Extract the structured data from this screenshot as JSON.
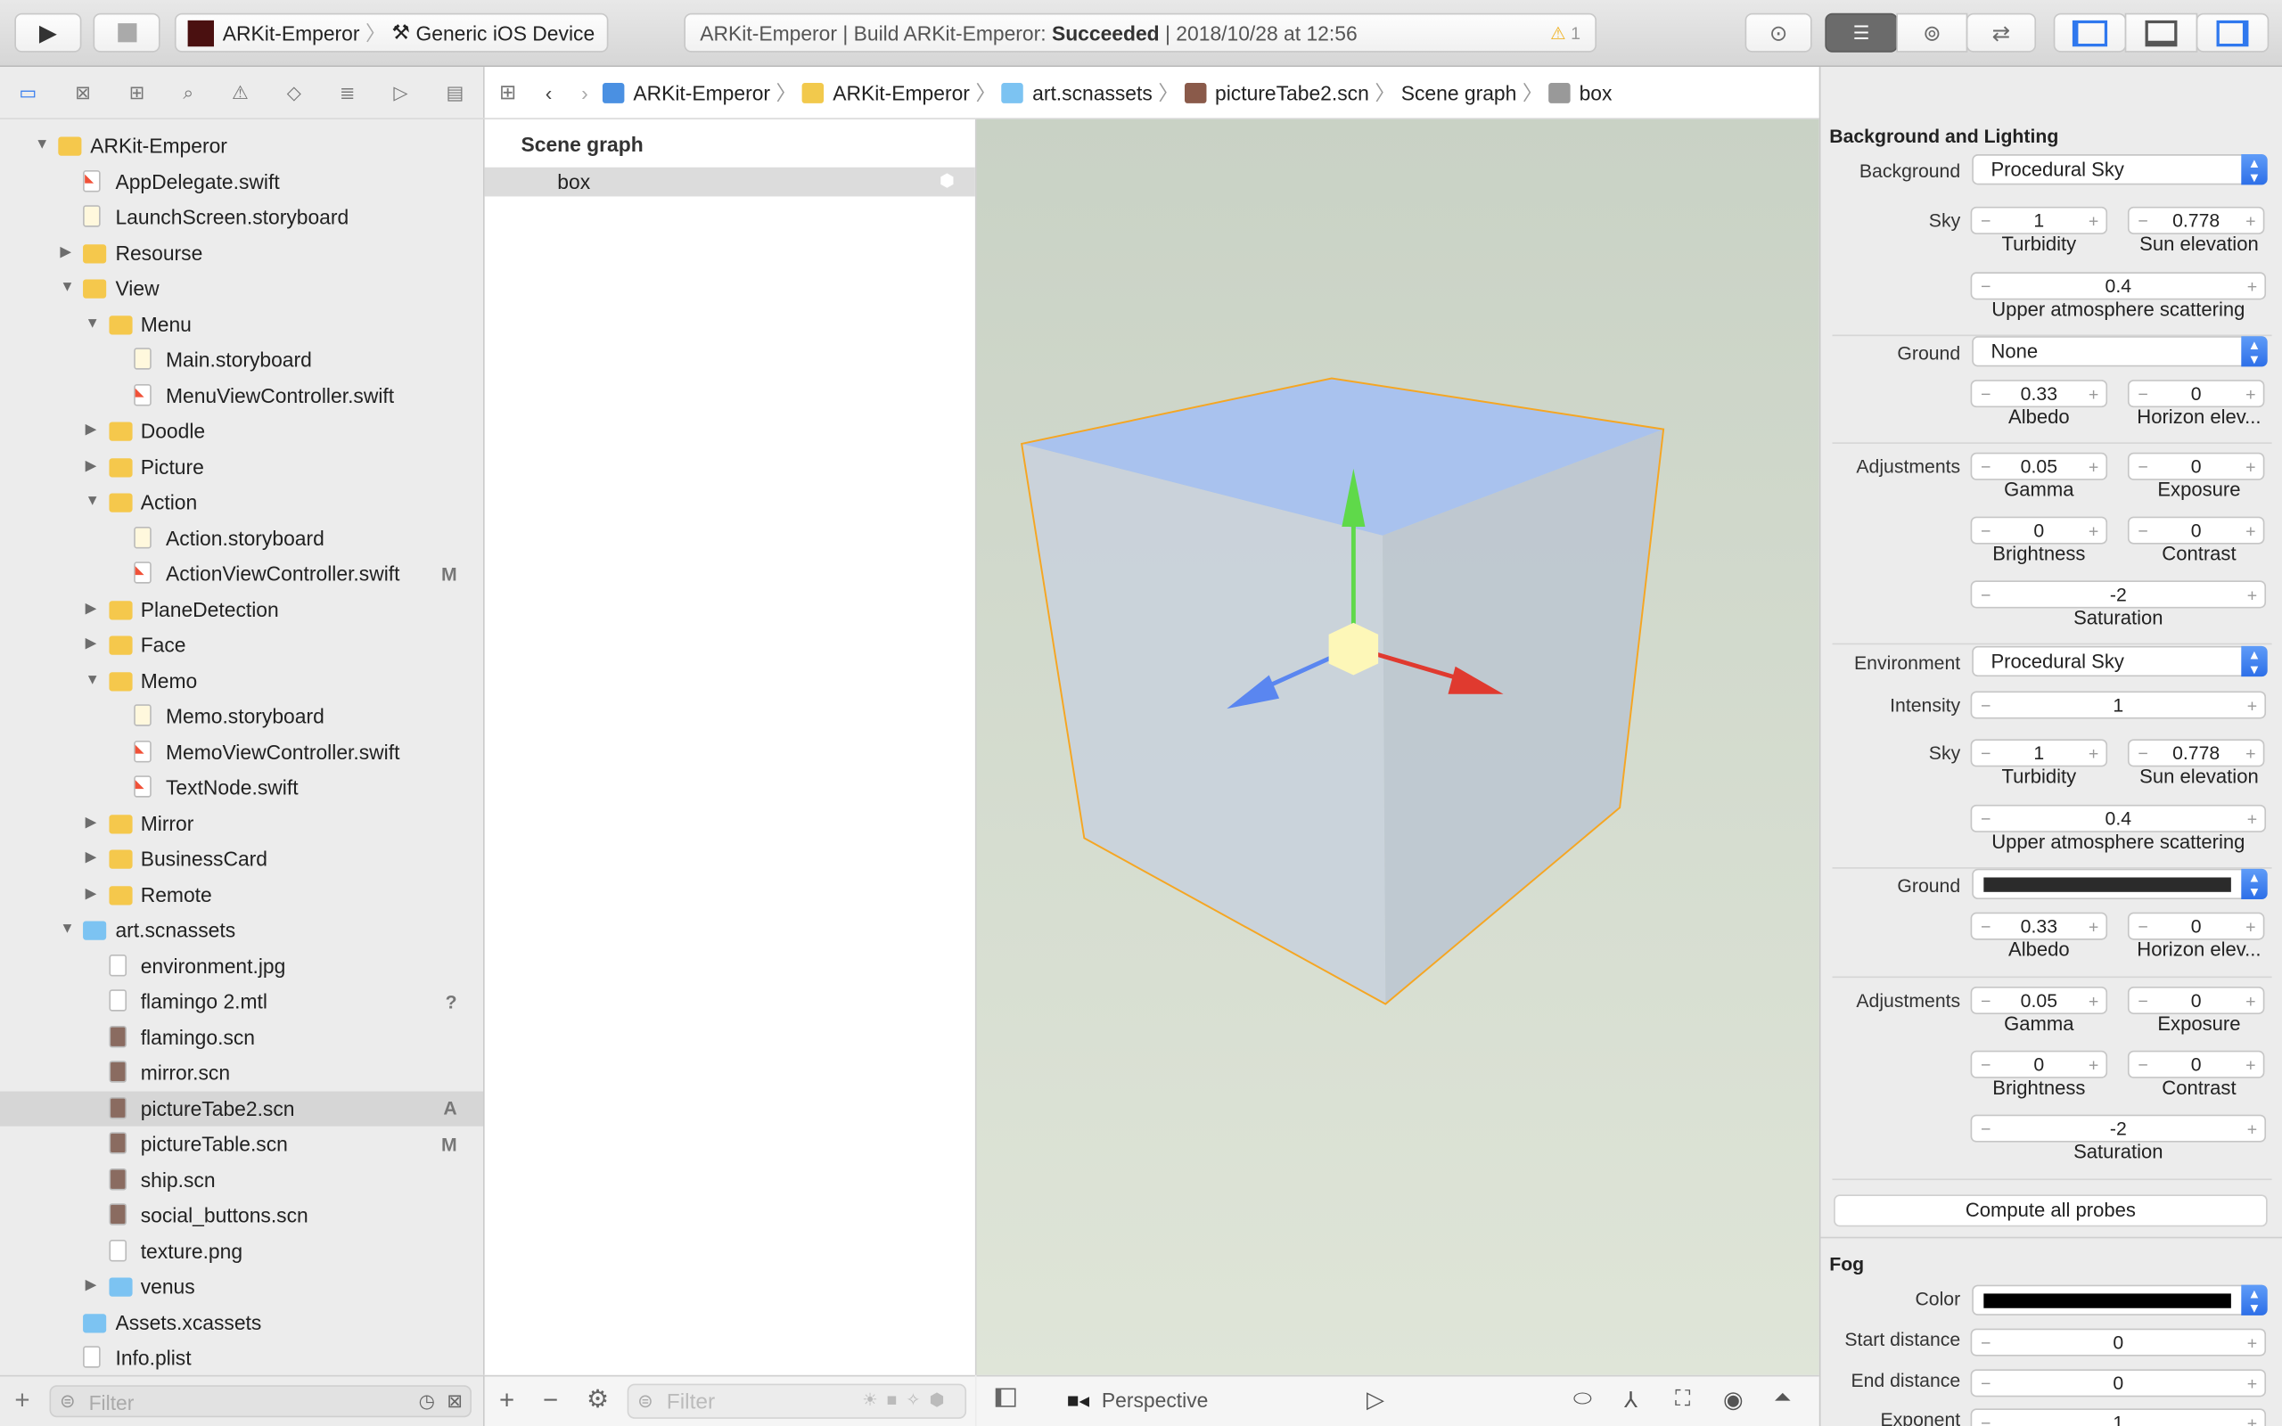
{
  "toolbar": {
    "scheme": "ARKit-Emperor",
    "device": "Generic iOS Device",
    "status_prefix": "ARKit-Emperor | Build ARKit-Emperor: ",
    "status_result": "Succeeded",
    "status_time": " | 2018/10/28 at 12:56",
    "warnings": "1"
  },
  "pathbar": [
    "ARKit-Emperor",
    "ARKit-Emperor",
    "art.scnassets",
    "pictureTabe2.scn",
    "Scene graph",
    "box"
  ],
  "navigator": {
    "filter_placeholder": "Filter",
    "items": [
      {
        "label": "ARKit-Emperor",
        "level": 0,
        "type": "folder",
        "open": true
      },
      {
        "label": "AppDelegate.swift",
        "level": 1,
        "type": "swift"
      },
      {
        "label": "LaunchScreen.storyboard",
        "level": 1,
        "type": "storyboard"
      },
      {
        "label": "Resourse",
        "level": 1,
        "type": "folder",
        "open": false
      },
      {
        "label": "View",
        "level": 1,
        "type": "folder",
        "open": true
      },
      {
        "label": "Menu",
        "level": 2,
        "type": "folder",
        "open": true
      },
      {
        "label": "Main.storyboard",
        "level": 3,
        "type": "storyboard"
      },
      {
        "label": "MenuViewController.swift",
        "level": 3,
        "type": "swift"
      },
      {
        "label": "Doodle",
        "level": 2,
        "type": "folder",
        "open": false
      },
      {
        "label": "Picture",
        "level": 2,
        "type": "folder",
        "open": false
      },
      {
        "label": "Action",
        "level": 2,
        "type": "folder",
        "open": true
      },
      {
        "label": "Action.storyboard",
        "level": 3,
        "type": "storyboard"
      },
      {
        "label": "ActionViewController.swift",
        "level": 3,
        "type": "swift",
        "badge": "M"
      },
      {
        "label": "PlaneDetection",
        "level": 2,
        "type": "folder",
        "open": false
      },
      {
        "label": "Face",
        "level": 2,
        "type": "folder",
        "open": false
      },
      {
        "label": "Memo",
        "level": 2,
        "type": "folder",
        "open": true
      },
      {
        "label": "Memo.storyboard",
        "level": 3,
        "type": "storyboard"
      },
      {
        "label": "MemoViewController.swift",
        "level": 3,
        "type": "swift"
      },
      {
        "label": "TextNode.swift",
        "level": 3,
        "type": "swift"
      },
      {
        "label": "Mirror",
        "level": 2,
        "type": "folder",
        "open": false
      },
      {
        "label": "BusinessCard",
        "level": 2,
        "type": "folder",
        "open": false
      },
      {
        "label": "Remote",
        "level": 2,
        "type": "folder",
        "open": false
      },
      {
        "label": "art.scnassets",
        "level": 1,
        "type": "bluefolder",
        "open": true
      },
      {
        "label": "environment.jpg",
        "level": 2,
        "type": "image"
      },
      {
        "label": "flamingo 2.mtl",
        "level": 2,
        "type": "file",
        "badge": "?"
      },
      {
        "label": "flamingo.scn",
        "level": 2,
        "type": "scn"
      },
      {
        "label": "mirror.scn",
        "level": 2,
        "type": "scn"
      },
      {
        "label": "pictureTabe2.scn",
        "level": 2,
        "type": "scn",
        "badge": "A",
        "selected": true
      },
      {
        "label": "pictureTable.scn",
        "level": 2,
        "type": "scn",
        "badge": "M"
      },
      {
        "label": "ship.scn",
        "level": 2,
        "type": "scn"
      },
      {
        "label": "social_buttons.scn",
        "level": 2,
        "type": "scn"
      },
      {
        "label": "texture.png",
        "level": 2,
        "type": "image"
      },
      {
        "label": "venus",
        "level": 2,
        "type": "bluefolder",
        "open": false
      },
      {
        "label": "Assets.xcassets",
        "level": 1,
        "type": "bluefolder"
      },
      {
        "label": "Info.plist",
        "level": 1,
        "type": "file"
      }
    ]
  },
  "scene": {
    "title": "Scene graph",
    "node": "box",
    "filter_placeholder": "Filter"
  },
  "viewport": {
    "camera": "Perspective"
  },
  "inspector": {
    "section": "Background and Lighting",
    "rows": [
      {
        "kind": "popup",
        "label": "Background",
        "value": "Procedural Sky"
      },
      {
        "kind": "pair",
        "label": "Sky",
        "a": "1",
        "al": "Turbidity",
        "b": "0.778",
        "bl": "Sun elevation"
      },
      {
        "kind": "wide",
        "value": "0.4",
        "sub": "Upper atmosphere scattering"
      },
      {
        "kind": "popup",
        "label": "Ground",
        "value": "None"
      },
      {
        "kind": "pair",
        "a": "0.33",
        "al": "Albedo",
        "b": "0",
        "bl": "Horizon elev..."
      },
      {
        "kind": "pair",
        "label": "Adjustments",
        "a": "0.05",
        "al": "Gamma",
        "b": "0",
        "bl": "Exposure"
      },
      {
        "kind": "pair",
        "a": "0",
        "al": "Brightness",
        "b": "0",
        "bl": "Contrast"
      },
      {
        "kind": "wide",
        "value": "-2",
        "sub": "Saturation"
      },
      {
        "kind": "popup",
        "label": "Environment",
        "value": "Procedural Sky"
      },
      {
        "kind": "single",
        "label": "Intensity",
        "value": "1"
      },
      {
        "kind": "pair",
        "label": "Sky",
        "a": "1",
        "al": "Turbidity",
        "b": "0.778",
        "bl": "Sun elevation"
      },
      {
        "kind": "wide",
        "value": "0.4",
        "sub": "Upper atmosphere scattering"
      },
      {
        "kind": "color",
        "label": "Ground",
        "color": "#2b2b2b"
      },
      {
        "kind": "pair",
        "a": "0.33",
        "al": "Albedo",
        "b": "0",
        "bl": "Horizon elev..."
      },
      {
        "kind": "pair",
        "label": "Adjustments",
        "a": "0.05",
        "al": "Gamma",
        "b": "0",
        "bl": "Exposure"
      },
      {
        "kind": "pair",
        "a": "0",
        "al": "Brightness",
        "b": "0",
        "bl": "Contrast"
      },
      {
        "kind": "wide",
        "value": "-2",
        "sub": "Saturation"
      }
    ],
    "compute_button": "Compute all probes",
    "fog": {
      "title": "Fog",
      "color_label": "Color",
      "color": "#000000",
      "fields": [
        {
          "label": "Start distance",
          "value": "0"
        },
        {
          "label": "End distance",
          "value": "0"
        },
        {
          "label": "Exponent",
          "value": "1"
        }
      ]
    }
  },
  "colors": {
    "accent": "#2f78ee",
    "selection_outline": "#f5a623",
    "axis_x": "#e03a2f",
    "axis_y": "#5fd94a",
    "axis_z": "#5a86f0"
  }
}
